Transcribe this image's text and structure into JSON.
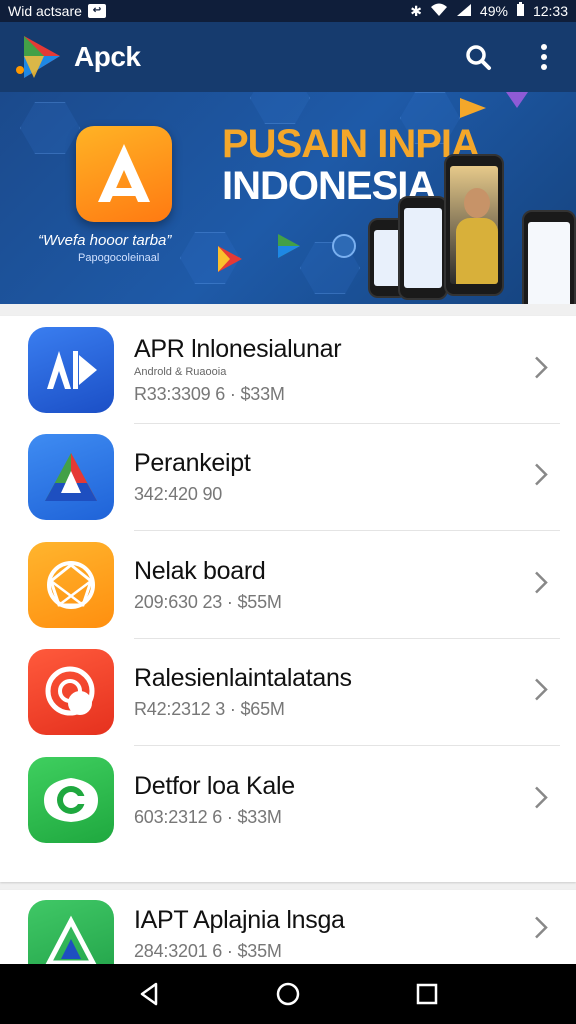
{
  "status_bar": {
    "carrier": "Wid actsare",
    "battery": "49%",
    "time": "12:33"
  },
  "app_bar": {
    "title": "Apck"
  },
  "banner": {
    "headline_1": "PUSAIN INPIA",
    "headline_2": "INDONESIA",
    "subline_1": "“Wvefa hooor tarba”",
    "subline_2": "Papogocoleinaal"
  },
  "apps": [
    {
      "name": "APR lnlonesialunar",
      "subtitle": "Androld & Ruaooia",
      "meta": "R33:3309 6  ·  $33M",
      "icon_color": "#2b68e0"
    },
    {
      "name": "Perankeipt",
      "subtitle": "",
      "meta": "342:420 90",
      "icon_color": "#2f7be8"
    },
    {
      "name": "Nelak board",
      "subtitle": "",
      "meta": "209:630 23  ·  $55M",
      "icon_color": "#ffa726"
    },
    {
      "name": "Ralesienlaintalatans",
      "subtitle": "",
      "meta": "R42:2312 3  ·  $65M",
      "icon_color": "#f4432f"
    },
    {
      "name": "Detfor loa Kale",
      "subtitle": "",
      "meta": "603:2312 6  ·  $33M",
      "icon_color": "#2ebd4e"
    }
  ],
  "apps_second": [
    {
      "name": "IAPT Aplajnia lnsga",
      "subtitle": "",
      "meta": "284:3201 6  ·  $35M",
      "icon_color": "#34b85a"
    }
  ],
  "colors": {
    "app_bar": "#163b6e",
    "banner": "#1e5aa8",
    "accent_orange": "#f4a72a"
  }
}
